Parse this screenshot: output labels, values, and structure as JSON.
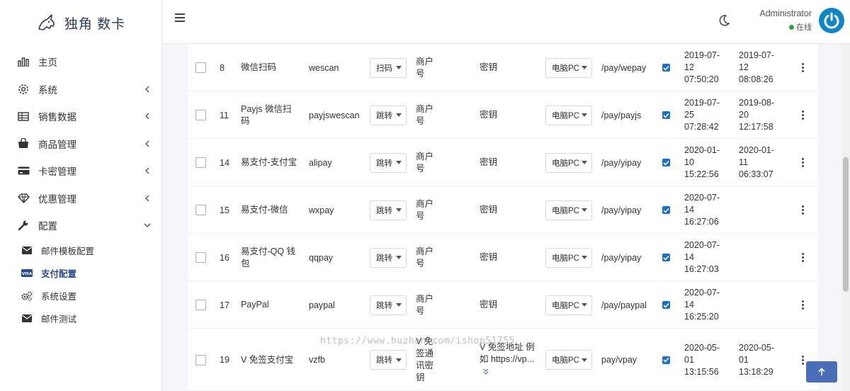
{
  "brand": {
    "name": "独角 数卡"
  },
  "sidebar": {
    "items": [
      {
        "label": "主页",
        "icon": "bar-chart-icon"
      },
      {
        "label": "系统",
        "icon": "gear-icon"
      },
      {
        "label": "销售数据",
        "icon": "table-icon"
      },
      {
        "label": "商品管理",
        "icon": "shopping-bag-icon"
      },
      {
        "label": "卡密管理",
        "icon": "credit-card-icon"
      },
      {
        "label": "优惠管理",
        "icon": "diamond-icon"
      },
      {
        "label": "配置",
        "icon": "wrench-icon"
      }
    ],
    "subitems": [
      {
        "label": "邮件模板配置",
        "icon": "envelope-icon"
      },
      {
        "label": "支付配置",
        "icon": "visa-card-icon"
      },
      {
        "label": "系统设置",
        "icon": "cogs-icon"
      },
      {
        "label": "邮件测试",
        "icon": "envelope-icon"
      }
    ]
  },
  "user": {
    "name": "Administrator",
    "status": "在线"
  },
  "colors": {
    "accent": "#2b4a8f",
    "online": "#28a745",
    "avatar": "#0e86c7",
    "checkbox": "#1a6fc9"
  },
  "rows": [
    {
      "id": "8",
      "name1": "微信扫码",
      "name2": "",
      "code": "wescan",
      "method": "扫码",
      "merchant1": "商户",
      "merchant2": "号",
      "merchant3": "",
      "key1": "密钥",
      "key2": "",
      "client": "电脑PC",
      "route": "/pay/wepay",
      "c1": "2019-07-",
      "c2": "12",
      "c3": "07:50:20",
      "u1": "2019-07-",
      "u2": "12",
      "u3": "08:08:26"
    },
    {
      "id": "11",
      "name1": "Payjs 微信扫",
      "name2": "码",
      "code": "payjswescan",
      "method": "跳转",
      "merchant1": "商户",
      "merchant2": "号",
      "merchant3": "",
      "key1": "密钥",
      "key2": "",
      "client": "电脑PC",
      "route": "/pay/payjs",
      "c1": "2019-07-",
      "c2": "25",
      "c3": "07:28:42",
      "u1": "2019-08-",
      "u2": "20",
      "u3": "12:17:58"
    },
    {
      "id": "14",
      "name1": "易支付-支付宝",
      "name2": "",
      "code": "alipay",
      "method": "跳转",
      "merchant1": "商户",
      "merchant2": "号",
      "merchant3": "",
      "key1": "密钥",
      "key2": "",
      "client": "电脑PC",
      "route": "/pay/yipay",
      "c1": "2020-01-",
      "c2": "10",
      "c3": "15:22:56",
      "u1": "2020-01-",
      "u2": "11",
      "u3": "06:33:07"
    },
    {
      "id": "15",
      "name1": "易支付-微信",
      "name2": "",
      "code": "wxpay",
      "method": "跳转",
      "merchant1": "商户",
      "merchant2": "号",
      "merchant3": "",
      "key1": "密钥",
      "key2": "",
      "client": "电脑PC",
      "route": "/pay/yipay",
      "c1": "2020-07-",
      "c2": "14",
      "c3": "16:27:06",
      "u1": "",
      "u2": "",
      "u3": ""
    },
    {
      "id": "16",
      "name1": "易支付-QQ 钱",
      "name2": "包",
      "code": "qqpay",
      "method": "跳转",
      "merchant1": "商户",
      "merchant2": "号",
      "merchant3": "",
      "key1": "密钥",
      "key2": "",
      "client": "电脑PC",
      "route": "/pay/yipay",
      "c1": "2020-07-",
      "c2": "14",
      "c3": "16:27:03",
      "u1": "",
      "u2": "",
      "u3": ""
    },
    {
      "id": "17",
      "name1": "PayPal",
      "name2": "",
      "code": "paypal",
      "method": "跳转",
      "merchant1": "商户",
      "merchant2": "号",
      "merchant3": "",
      "key1": "密钥",
      "key2": "",
      "client": "电脑PC",
      "route": "/pay/paypal",
      "c1": "2020-07-",
      "c2": "14",
      "c3": "16:25:20",
      "u1": "",
      "u2": "",
      "u3": ""
    },
    {
      "id": "19",
      "name1": "V 免签支付宝",
      "name2": "",
      "code": "vzfb",
      "method": "跳转",
      "merchant1": "V 免",
      "merchant2": "签通",
      "merchant3": "讯密",
      "merchant4": "钥",
      "key1": "V 免签地址 例",
      "key2": "如 https://vp...",
      "client": "电脑PC",
      "route": "pay/vpay",
      "c1": "2020-05-",
      "c2": "01",
      "c3": "13:15:56",
      "u1": "2020-05-",
      "u2": "01",
      "u3": "13:18:29"
    }
  ],
  "watermark": "https://www.huzhan.com/ishop51755"
}
